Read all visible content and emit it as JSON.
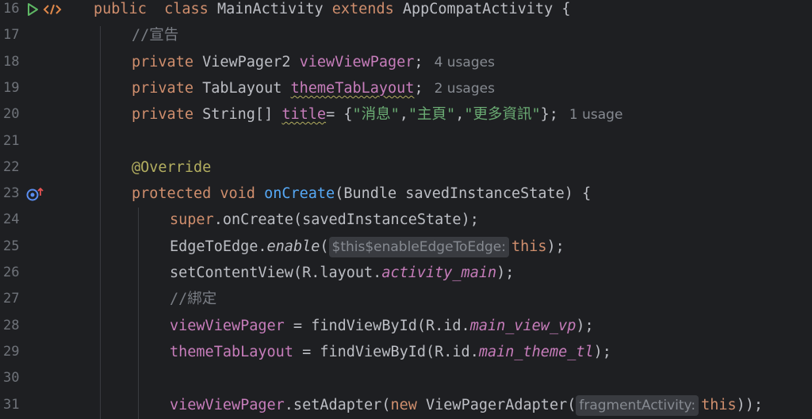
{
  "editor": {
    "lines": [
      {
        "no": "16",
        "tokens": [
          [
            "kw",
            "public"
          ],
          [
            "",
            "  "
          ],
          [
            "kw",
            "class"
          ],
          [
            "",
            " MainActivity "
          ],
          [
            "kw",
            "extends"
          ],
          [
            "",
            " AppCompatActivity {"
          ]
        ]
      },
      {
        "no": "17",
        "tokens": [
          [
            "cm",
            "//宣告"
          ]
        ]
      },
      {
        "no": "18",
        "tokens": [
          [
            "kw",
            "private"
          ],
          [
            "",
            " ViewPager2 "
          ],
          [
            "fld",
            "viewViewPager"
          ],
          [
            "",
            ";"
          ]
        ],
        "usage": "4 usages"
      },
      {
        "no": "19",
        "tokens": [
          [
            "kw",
            "private"
          ],
          [
            "",
            " TabLayout "
          ],
          [
            "fld wavy",
            "themeTabLayout"
          ],
          [
            "",
            ";"
          ]
        ],
        "usage": "2 usages"
      },
      {
        "no": "20",
        "tokens": [
          [
            "kw",
            "private"
          ],
          [
            "",
            " String[] "
          ],
          [
            "fld wavy",
            "title"
          ],
          [
            "",
            "= {"
          ],
          [
            "str",
            "\"消息\""
          ],
          [
            "",
            ","
          ],
          [
            "str",
            "\"主頁\""
          ],
          [
            "",
            ","
          ],
          [
            "str",
            "\"更多資訊\""
          ],
          [
            "",
            "};"
          ]
        ],
        "usage": "1 usage"
      },
      {
        "no": "21",
        "tokens": []
      },
      {
        "no": "22",
        "tokens": [
          [
            "ann",
            "@Override"
          ]
        ]
      },
      {
        "no": "23",
        "tokens": [
          [
            "kw",
            "protected"
          ],
          [
            "",
            ""
          ],
          [
            "kw",
            " void"
          ],
          [
            "",
            ""
          ],
          [
            "fn",
            " onCreate"
          ],
          [
            "",
            "(Bundle savedInstanceState) {"
          ]
        ]
      },
      {
        "no": "24",
        "tokens": [
          [
            "kw",
            "super"
          ],
          [
            "",
            ".onCreate(savedInstanceState);"
          ]
        ]
      },
      {
        "no": "25",
        "tokens": [
          [
            "",
            "EdgeToEdge."
          ],
          [
            "it",
            "enable"
          ],
          [
            "",
            "("
          ],
          [
            "hint",
            "$this$enableEdgeToEdge:"
          ],
          [
            "kw",
            "this"
          ],
          [
            "",
            ");"
          ]
        ]
      },
      {
        "no": "26",
        "tokens": [
          [
            "",
            "setContentView(R.layout."
          ],
          [
            "fld it",
            "activity_main"
          ],
          [
            "",
            ");"
          ]
        ]
      },
      {
        "no": "27",
        "tokens": [
          [
            "cm",
            "//綁定"
          ]
        ]
      },
      {
        "no": "28",
        "tokens": [
          [
            "fld",
            "viewViewPager"
          ],
          [
            "",
            " = findViewById(R.id."
          ],
          [
            "fld it",
            "main_view_vp"
          ],
          [
            "",
            ");"
          ]
        ]
      },
      {
        "no": "29",
        "tokens": [
          [
            "fld",
            "themeTabLayout"
          ],
          [
            "",
            " = findViewById(R.id."
          ],
          [
            "fld it",
            "main_theme_tl"
          ],
          [
            "",
            ");"
          ]
        ]
      },
      {
        "no": "30",
        "tokens": []
      },
      {
        "no": "31",
        "tokens": [
          [
            "fld",
            "viewViewPager"
          ],
          [
            "",
            ".setAdapter("
          ],
          [
            "kw",
            "new"
          ],
          [
            "",
            " ViewPagerAdapter("
          ],
          [
            "hint",
            "fragmentActivity:"
          ],
          [
            "kw",
            "this"
          ],
          [
            "",
            "));"
          ]
        ]
      }
    ]
  },
  "icons": {
    "run": "run-gutter-icon",
    "code": "code-tags-gutter-icon",
    "override": "override-method-gutter-icon"
  }
}
